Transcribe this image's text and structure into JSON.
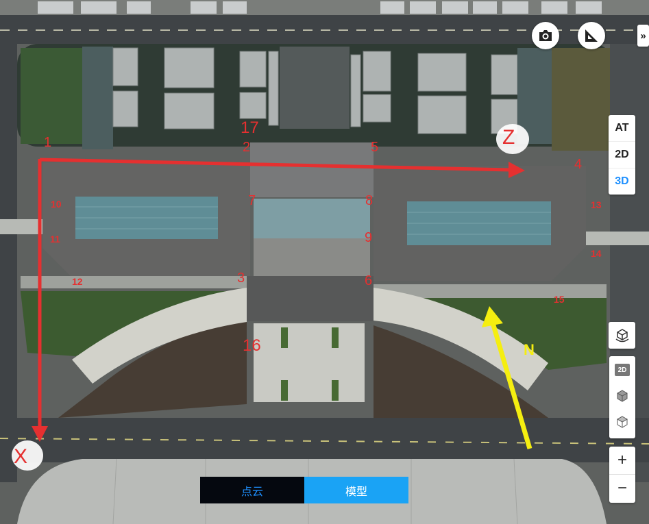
{
  "map": {
    "axis_labels": {
      "x": "X",
      "z": "Z",
      "north": "N"
    },
    "points": [
      "1",
      "2",
      "3",
      "4",
      "5",
      "6",
      "7",
      "8",
      "9",
      "10",
      "11",
      "12",
      "13",
      "14",
      "15",
      "16",
      "17"
    ]
  },
  "toolbar": {
    "view_modes": [
      "AT",
      "2D",
      "3D"
    ],
    "active_mode": "3D",
    "expand_glyph": "»",
    "zoom_in": "+",
    "zoom_out": "−",
    "view_2d_label": "2D"
  },
  "segmented": {
    "left_label": "点云",
    "right_label": "模型",
    "active": "模型"
  },
  "colors": {
    "accent": "#1e90ff",
    "annotation": "#e53030",
    "north_arrow": "#f5ee10",
    "segment_dark": "#05080f",
    "segment_active": "#1aa3f5"
  }
}
